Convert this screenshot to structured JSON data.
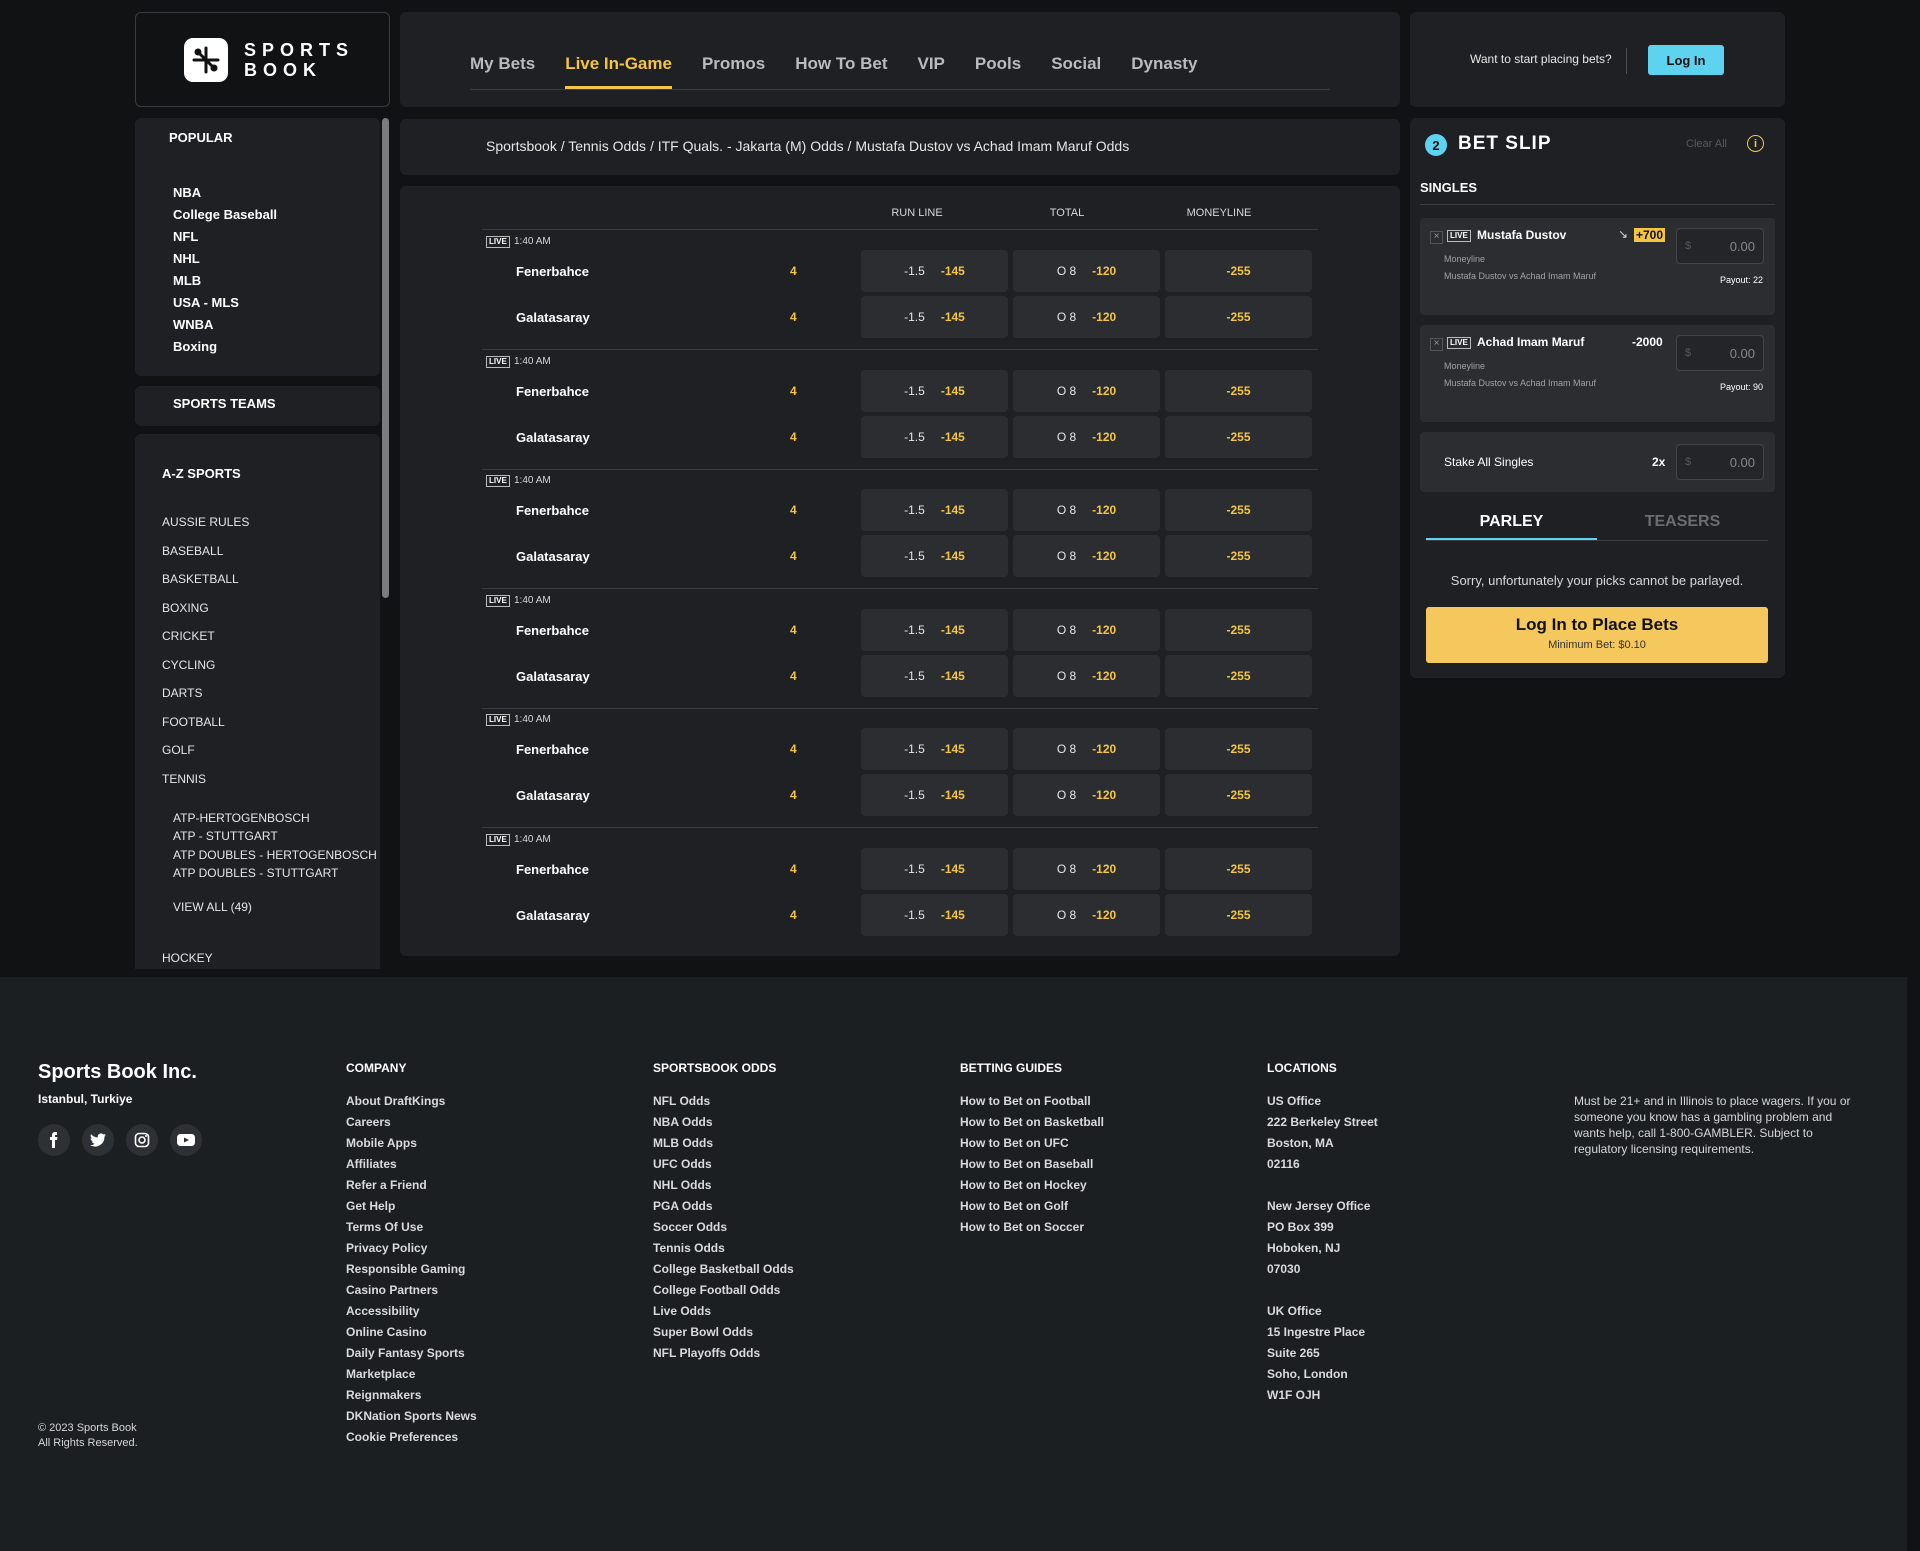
{
  "header": {
    "logo_line1": "SPORTS",
    "logo_line2": "BOOK",
    "nav": [
      "My Bets",
      "Live In-Game",
      "Promos",
      "How To Bet",
      "VIP",
      "Pools",
      "Social",
      "Dynasty"
    ],
    "active_nav": "Live In-Game",
    "login_prompt": "Want to start placing bets?",
    "login_button": "Log In"
  },
  "sidebar": {
    "popular_title": "POPULAR",
    "popular": [
      "NBA",
      "College Baseball",
      "NFL",
      "NHL",
      "MLB",
      "USA - MLS",
      "WNBA",
      "Boxing"
    ],
    "teams_title": "SPORTS TEAMS",
    "az_title": "A-Z SPORTS",
    "az": [
      "AUSSIE RULES",
      "BASEBALL",
      "BASKETBALL",
      "BOXING",
      "CRICKET",
      "CYCLING",
      "DARTS",
      "FOOTBALL",
      "GOLF",
      "TENNIS"
    ],
    "tennis_sub": [
      "ATP-HERTOGENBOSCH",
      "ATP - STUTTGART",
      "ATP DOUBLES - HERTOGENBOSCH",
      "ATP DOUBLES - STUTTGART"
    ],
    "view_all": "VIEW ALL (49)",
    "after": "HOCKEY"
  },
  "breadcrumb": "Sportsbook / Tennis Odds / ITF Quals. - Jakarta (M) Odds / Mustafa Dustov vs Achad Imam Maruf Odds",
  "table": {
    "columns": [
      "RUN LINE",
      "TOTAL",
      "MONEYLINE"
    ],
    "events": [
      {
        "live": "LIVE",
        "time": "1:40 AM",
        "rows": [
          {
            "team": "Fenerbahce",
            "score": "4",
            "run_pt": "-1.5",
            "run_odds": "-145",
            "total_pt": "O 8",
            "total_odds": "-120",
            "ml": "-255"
          },
          {
            "team": "Galatasaray",
            "score": "4",
            "run_pt": "-1.5",
            "run_odds": "-145",
            "total_pt": "O 8",
            "total_odds": "-120",
            "ml": "-255"
          }
        ]
      },
      {
        "live": "LIVE",
        "time": "1:40 AM",
        "rows": [
          {
            "team": "Fenerbahce",
            "score": "4",
            "run_pt": "-1.5",
            "run_odds": "-145",
            "total_pt": "O 8",
            "total_odds": "-120",
            "ml": "-255"
          },
          {
            "team": "Galatasaray",
            "score": "4",
            "run_pt": "-1.5",
            "run_odds": "-145",
            "total_pt": "O 8",
            "total_odds": "-120",
            "ml": "-255"
          }
        ]
      },
      {
        "live": "LIVE",
        "time": "1:40 AM",
        "rows": [
          {
            "team": "Fenerbahce",
            "score": "4",
            "run_pt": "-1.5",
            "run_odds": "-145",
            "total_pt": "O 8",
            "total_odds": "-120",
            "ml": "-255"
          },
          {
            "team": "Galatasaray",
            "score": "4",
            "run_pt": "-1.5",
            "run_odds": "-145",
            "total_pt": "O 8",
            "total_odds": "-120",
            "ml": "-255"
          }
        ]
      },
      {
        "live": "LIVE",
        "time": "1:40 AM",
        "rows": [
          {
            "team": "Fenerbahce",
            "score": "4",
            "run_pt": "-1.5",
            "run_odds": "-145",
            "total_pt": "O 8",
            "total_odds": "-120",
            "ml": "-255"
          },
          {
            "team": "Galatasaray",
            "score": "4",
            "run_pt": "-1.5",
            "run_odds": "-145",
            "total_pt": "O 8",
            "total_odds": "-120",
            "ml": "-255"
          }
        ]
      },
      {
        "live": "LIVE",
        "time": "1:40 AM",
        "rows": [
          {
            "team": "Fenerbahce",
            "score": "4",
            "run_pt": "-1.5",
            "run_odds": "-145",
            "total_pt": "O 8",
            "total_odds": "-120",
            "ml": "-255"
          },
          {
            "team": "Galatasaray",
            "score": "4",
            "run_pt": "-1.5",
            "run_odds": "-145",
            "total_pt": "O 8",
            "total_odds": "-120",
            "ml": "-255"
          }
        ]
      },
      {
        "live": "LIVE",
        "time": "1:40 AM",
        "rows": [
          {
            "team": "Fenerbahce",
            "score": "4",
            "run_pt": "-1.5",
            "run_odds": "-145",
            "total_pt": "O 8",
            "total_odds": "-120",
            "ml": "-255"
          },
          {
            "team": "Galatasaray",
            "score": "4",
            "run_pt": "-1.5",
            "run_odds": "-145",
            "total_pt": "O 8",
            "total_odds": "-120",
            "ml": "-255"
          }
        ]
      }
    ]
  },
  "betslip": {
    "count": "2",
    "title": "BET SLIP",
    "clear": "Clear All",
    "info_icon": "i",
    "singles": "SINGLES",
    "bets": [
      {
        "live": "LIVE",
        "name": "Mustafa Dustov",
        "odds": "+700",
        "type": "Moneyline",
        "match": "Mustafa Dustov vs Achad Imam Maruf",
        "currency": "$",
        "stake_placeholder": "0.00",
        "payout": "Payout: 22",
        "trend_icon": "↘"
      },
      {
        "live": "LIVE",
        "name": "Achad Imam Maruf",
        "odds": "-2000",
        "type": "Moneyline",
        "match": "Mustafa Dustov vs Achad Imam Maruf",
        "currency": "$",
        "stake_placeholder": "0.00",
        "payout": "Payout: 90"
      }
    ],
    "stake_all_label": "Stake All Singles",
    "stake_all_mult": "2x",
    "stake_all_currency": "$",
    "stake_all_placeholder": "0.00",
    "tabs": [
      "PARLEY",
      "TEASERS"
    ],
    "sorry": "Sorry, unfortunately your picks cannot be parlayed.",
    "place_label": "Log In to Place Bets",
    "min_bet": "Minimum Bet: $0.10"
  },
  "footer": {
    "brand": "Sports Book Inc.",
    "city": "Istanbul, Turkiye",
    "social": [
      "facebook-icon",
      "twitter-icon",
      "instagram-icon",
      "youtube-icon"
    ],
    "company_title": "COMPANY",
    "company": [
      "About DraftKings",
      "Careers",
      "Mobile Apps",
      "Affiliates",
      "Refer a Friend",
      "Get Help",
      "Terms Of Use",
      "Privacy Policy",
      "Responsible Gaming",
      "Casino Partners",
      "Accessibility",
      "Online Casino",
      "Daily Fantasy Sports",
      "Marketplace",
      "Reignmakers",
      "DKNation Sports News",
      "Cookie Preferences"
    ],
    "odds_title": "SPORTSBOOK ODDS",
    "odds": [
      "NFL Odds",
      "NBA Odds",
      "MLB Odds",
      "UFC Odds",
      "NHL Odds",
      "PGA Odds",
      "Soccer Odds",
      "Tennis Odds",
      "College Basketball Odds",
      "College Football Odds",
      "Live Odds",
      "Super Bowl Odds",
      "NFL Playoffs Odds"
    ],
    "guides_title": "BETTING GUIDES",
    "guides": [
      "How to Bet on Football",
      "How to Bet on Basketball",
      "How to Bet on UFC",
      "How to Bet on Baseball",
      "How to Bet on Hockey",
      "How to Bet on Golf",
      "How to Bet on Soccer"
    ],
    "locations_title": "LOCATIONS",
    "locations": [
      [
        "US Office",
        "222 Berkeley Street",
        "Boston, MA",
        "02116"
      ],
      [
        "New Jersey Office",
        "PO Box 399",
        "Hoboken, NJ",
        "07030"
      ],
      [
        "UK Office",
        "15 Ingestre Place",
        "Suite 265",
        "Soho, London",
        "W1F OJH"
      ]
    ],
    "legal": "Must be 21+ and in Illinois to place wagers. If you or someone you know has a gambling problem and wants help, call 1-800-GAMBLER. Subject to regulatory licensing requirements.",
    "copyright": "© 2023 Sports Book",
    "rights": "All Rights Reserved."
  },
  "colors": {
    "accent_yellow": "#f4c542",
    "accent_cyan": "#5ed3f0",
    "panel": "#1e2023",
    "cell": "#2b2d31"
  }
}
